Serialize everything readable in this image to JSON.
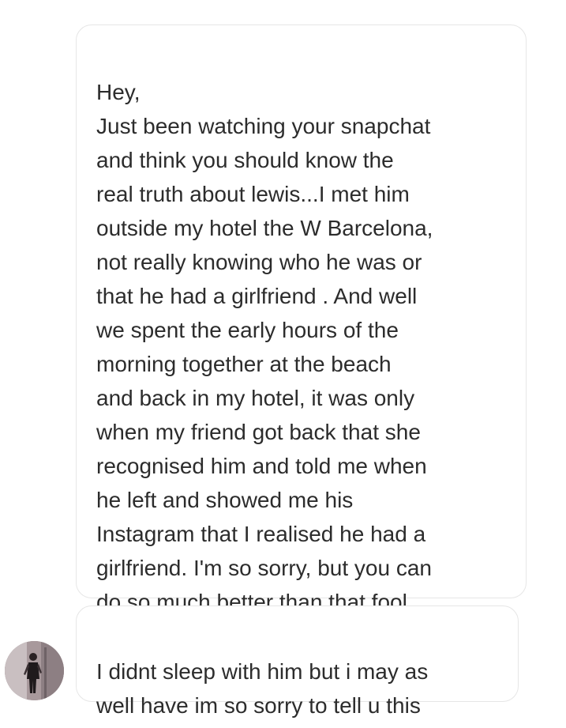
{
  "conversation": {
    "sender_name_partial": "",
    "messages": [
      {
        "text": "Hey,\nJust been watching your snapchat\nand think you should know the\nreal truth about lewis...I met him\noutside my hotel the W Barcelona,\nnot really knowing who he was or\nthat he had a girlfriend . And well\nwe spent the early hours of the\nmorning together at the beach\nand back in my hotel, it was only\nwhen my friend got back that she\nrecognised him and told me when\nhe left and showed me his\nInstagram that I realised he had a\ngirlfriend. I'm so sorry, but you can\ndo so much better than that fool."
      },
      {
        "text": "I didnt sleep with him but i may as\nwell have im so sorry to tell u this"
      }
    ]
  },
  "avatar": {
    "icon": "user-avatar-photo",
    "colors": {
      "background": "#9a8a8e",
      "figure": "#1f1a1c"
    }
  }
}
